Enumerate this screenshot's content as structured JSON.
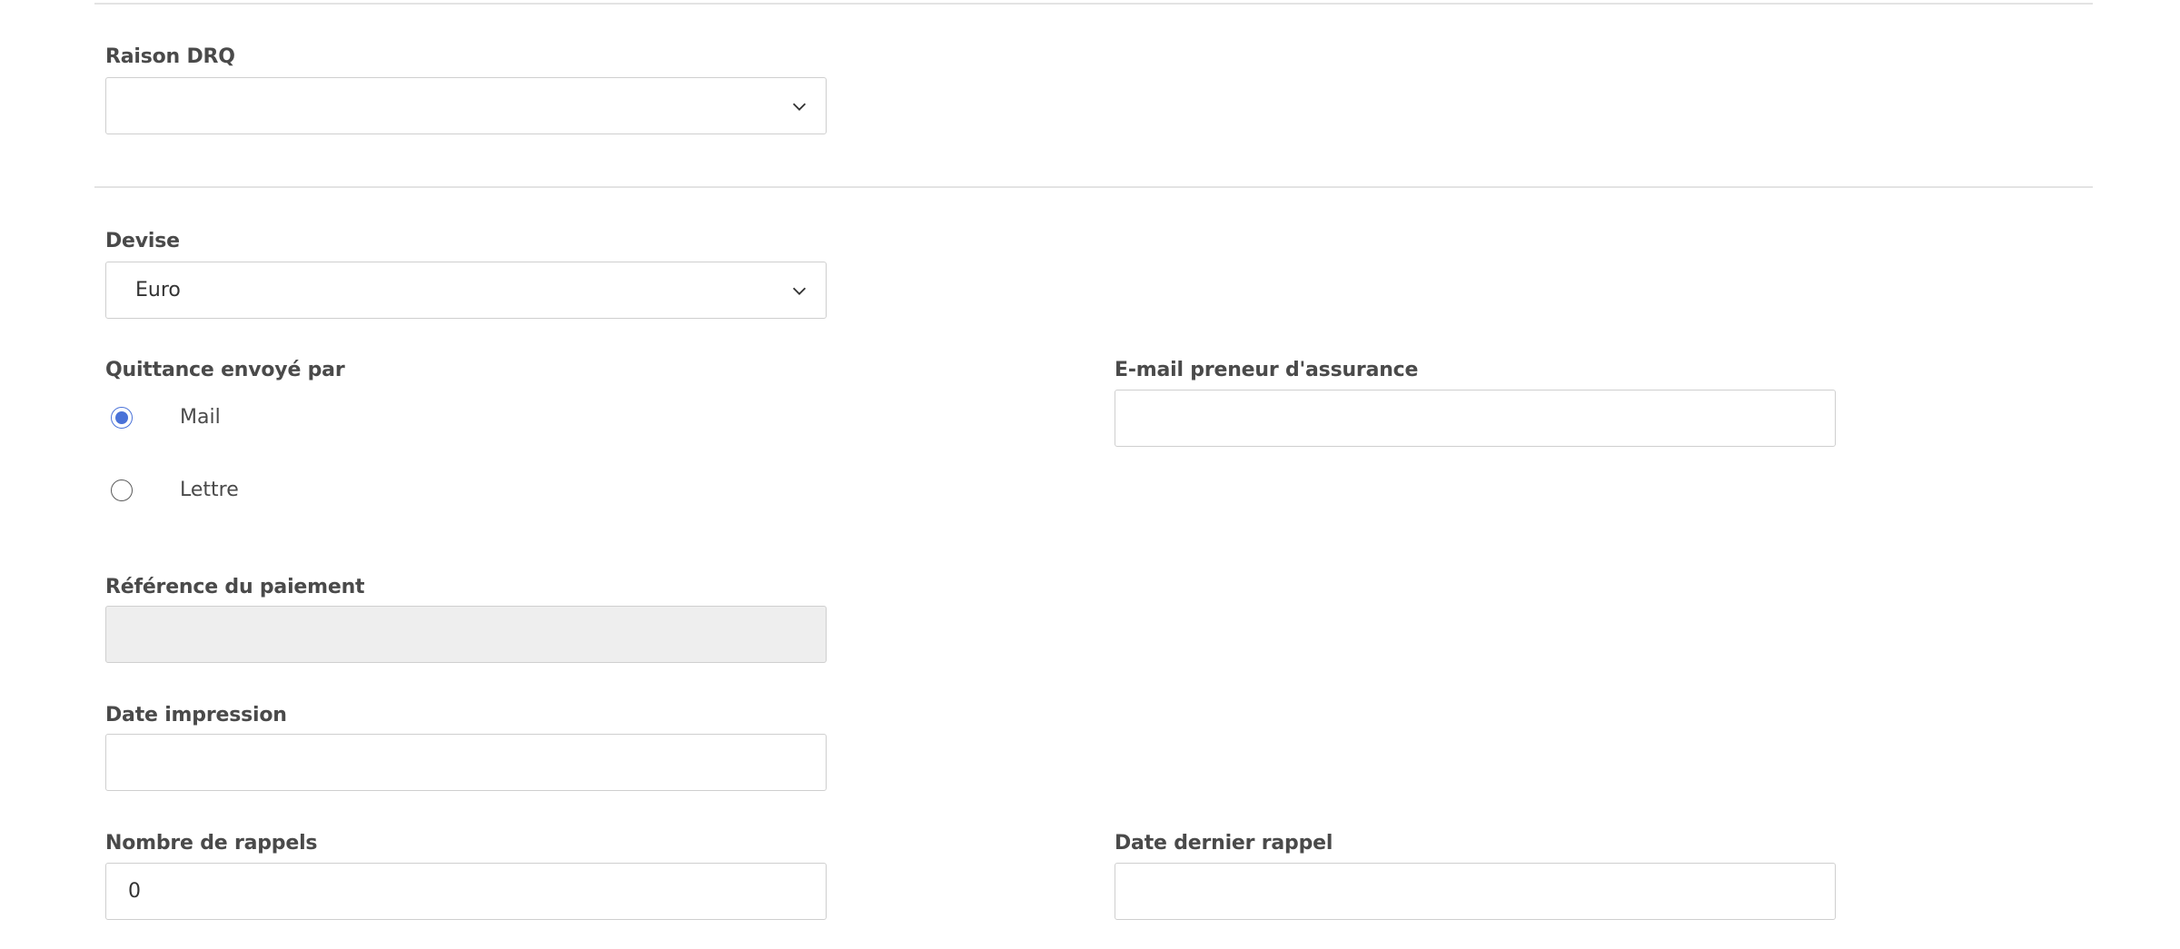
{
  "sections": {
    "raison_drq": {
      "label": "Raison DRQ",
      "value": ""
    },
    "devise": {
      "label": "Devise",
      "value": "Euro"
    },
    "quittance": {
      "label": "Quittance envoyé par",
      "options": [
        {
          "label": "Mail",
          "checked": true
        },
        {
          "label": "Lettre",
          "checked": false
        }
      ]
    },
    "email_preneur": {
      "label": "E-mail preneur d'assurance",
      "value": ""
    },
    "reference_paiement": {
      "label": "Référence du paiement",
      "value": ""
    },
    "date_impression": {
      "label": "Date impression",
      "value": ""
    },
    "nombre_rappels": {
      "label": "Nombre de rappels",
      "value": "0"
    },
    "date_dernier_rappel": {
      "label": "Date dernier rappel",
      "value": ""
    }
  },
  "icons": {
    "select_chevron": "chevron-down-icon",
    "radio_checked_color": "#4a72d8"
  }
}
